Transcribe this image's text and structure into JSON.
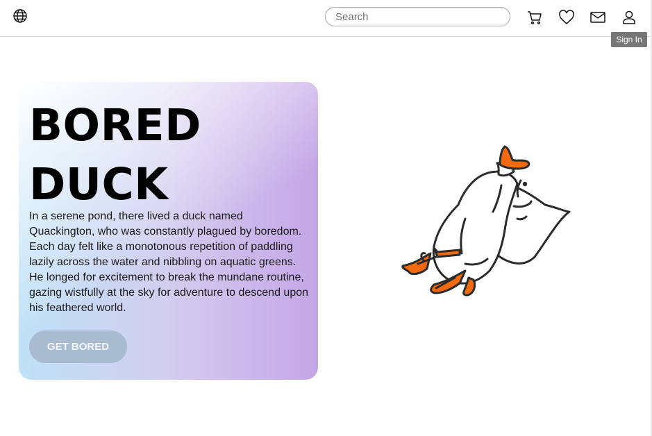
{
  "header": {
    "search_placeholder": "Search",
    "icons": [
      "globe-icon",
      "cart-icon",
      "heart-icon",
      "mail-icon",
      "user-icon"
    ],
    "tooltip": "Sign In"
  },
  "hero": {
    "title_line1": "BORED",
    "title_line2": "DUCK",
    "description": "In a serene pond, there lived a duck named Quackington, who was constantly plagued by boredom. Each day felt like a monotonous repetition of paddling lazily across the water and nibbling on aquatic greens. He longed for excitement to break the mundane routine, gazing wistfully at the sky for adventure to descend upon his feathered world.",
    "cta_label": "GET BORED"
  },
  "colors": {
    "accent_orange": "#f26a10",
    "button": "#a9bccf",
    "gradient_left": "#bee1f7",
    "gradient_right": "#c4a6e6"
  }
}
